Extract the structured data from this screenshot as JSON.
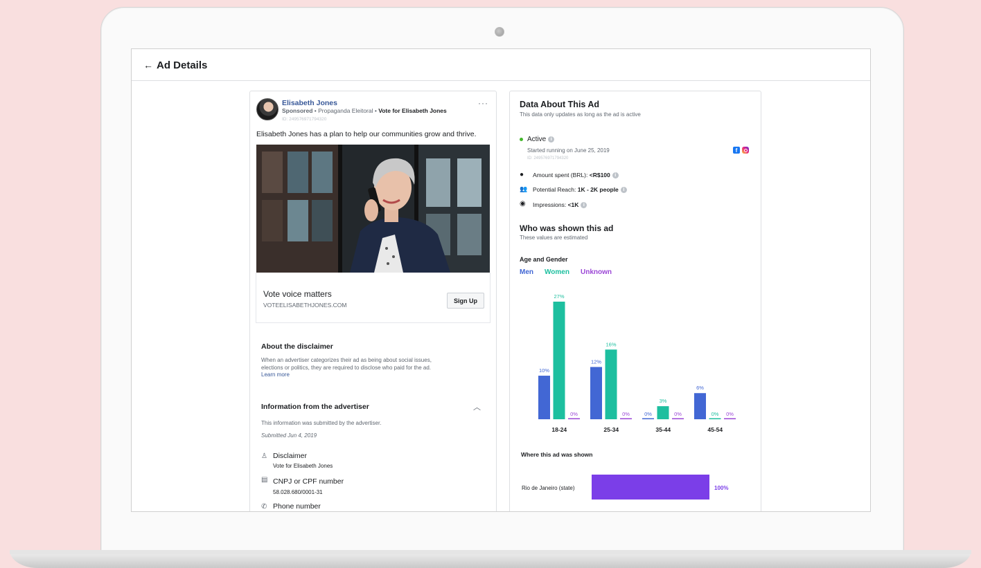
{
  "header": {
    "back_icon": "back-arrow-icon",
    "title": "Ad Details"
  },
  "ad": {
    "advertiser": "Elisabeth Jones",
    "sponsored": "Sponsored",
    "category": "Propaganda Eleitoral",
    "paid_by": "Vote for Elisabeth Jones",
    "id": "ID: 249576971794320",
    "more_icon": "more-options-icon",
    "text": "Elisabeth Jones has a plan to help our communities grow and thrive.",
    "link_title": "Vote voice matters",
    "link_url": "VOTEELISABETHJONES.COM",
    "cta": "Sign Up"
  },
  "disclaimer": {
    "title": "About the disclaimer",
    "body1": "When an advertiser categorizes their ad as being about social issues,",
    "body2": "elections or politics, they are required to disclose who paid for the ad.",
    "learn_more": "Learn more"
  },
  "advertiser_info": {
    "title": "Information from the advertiser",
    "submitted_note": "This information was submitted by the advertiser.",
    "submitted_date": "Submitted Jun 4, 2019",
    "fields": [
      {
        "icon": "person-icon",
        "label": "Disclaimer",
        "value": "Vote for Elisabeth Jones"
      },
      {
        "icon": "document-icon",
        "label": "CNPJ or CPF number",
        "value": "58.028.680/0001-31"
      },
      {
        "icon": "phone-icon",
        "label": "Phone number",
        "value": ""
      }
    ]
  },
  "data_panel": {
    "title": "Data About This Ad",
    "subtitle": "This data only updates as long as the ad is active",
    "status": "Active",
    "started": "Started running on June 25, 2019",
    "id": "ID: 249576971794320",
    "amount_label": "Amount spent (BRL):",
    "amount_value": "<R$100",
    "reach_label": "Potential Reach:",
    "reach_value": "1K - 2K people",
    "impressions_label": "Impressions:",
    "impressions_value": "<1K",
    "who_title": "Who was shown this ad",
    "who_sub": "These values are estimated",
    "age_gender_title": "Age and Gender",
    "where_title": "Where this ad was shown",
    "region": "Rio de Janeiro (state)",
    "region_pct": "100%",
    "region_fraction": 1.0
  },
  "colors": {
    "men": "#4267d4",
    "women": "#1dbf9f",
    "unknown": "#9b46d6",
    "region": "#7b3ee8",
    "active": "#42b72a"
  },
  "chart_data": {
    "type": "bar",
    "categories": [
      "18-24",
      "25-34",
      "35-44",
      "45-54"
    ],
    "series": [
      {
        "name": "Men",
        "values": [
          10,
          12,
          0,
          6
        ]
      },
      {
        "name": "Women",
        "values": [
          27,
          16,
          3,
          0
        ]
      },
      {
        "name": "Unknown",
        "values": [
          0,
          0,
          0,
          0
        ]
      }
    ],
    "value_suffix": "%",
    "ylim": [
      0,
      27
    ]
  }
}
